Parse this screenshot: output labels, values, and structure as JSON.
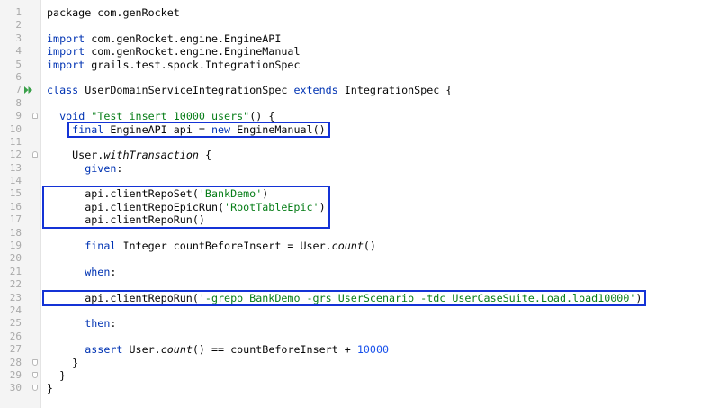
{
  "editor": {
    "lines": [
      {
        "n": "1",
        "tokens": [
          {
            "t": "package com.genRocket",
            "c": ""
          }
        ]
      },
      {
        "n": "2",
        "tokens": []
      },
      {
        "n": "3",
        "tokens": [
          {
            "t": "import",
            "c": "kw"
          },
          {
            "t": " com.genRocket.engine.EngineAPI",
            "c": ""
          }
        ]
      },
      {
        "n": "4",
        "tokens": [
          {
            "t": "import",
            "c": "kw"
          },
          {
            "t": " com.genRocket.engine.EngineManual",
            "c": ""
          }
        ]
      },
      {
        "n": "5",
        "tokens": [
          {
            "t": "import",
            "c": "kw"
          },
          {
            "t": " grails.test.spock.IntegrationSpec",
            "c": ""
          }
        ]
      },
      {
        "n": "6",
        "tokens": []
      },
      {
        "n": "7",
        "tokens": [
          {
            "t": "class",
            "c": "kw"
          },
          {
            "t": " UserDomainServiceIntegrationSpec ",
            "c": ""
          },
          {
            "t": "extends",
            "c": "kw"
          },
          {
            "t": " IntegrationSpec {",
            "c": ""
          }
        ]
      },
      {
        "n": "8",
        "tokens": []
      },
      {
        "n": "9",
        "tokens": [
          {
            "t": "  ",
            "c": ""
          },
          {
            "t": "void",
            "c": "kw"
          },
          {
            "t": " ",
            "c": ""
          },
          {
            "t": "\"Test insert 10000 users\"",
            "c": "str"
          },
          {
            "t": "() {",
            "c": ""
          }
        ]
      },
      {
        "n": "10",
        "tokens": [
          {
            "t": "    ",
            "c": ""
          },
          {
            "t": "final",
            "c": "kw"
          },
          {
            "t": " EngineAPI api = ",
            "c": ""
          },
          {
            "t": "new",
            "c": "kw"
          },
          {
            "t": " EngineManual()",
            "c": ""
          }
        ]
      },
      {
        "n": "11",
        "tokens": []
      },
      {
        "n": "12",
        "tokens": [
          {
            "t": "    User.",
            "c": ""
          },
          {
            "t": "withTransaction",
            "c": "it"
          },
          {
            "t": " {",
            "c": ""
          }
        ]
      },
      {
        "n": "13",
        "tokens": [
          {
            "t": "      ",
            "c": ""
          },
          {
            "t": "given",
            "c": "kw"
          },
          {
            "t": ":",
            "c": ""
          }
        ]
      },
      {
        "n": "14",
        "tokens": []
      },
      {
        "n": "15",
        "tokens": [
          {
            "t": "      api.clientRepoSet(",
            "c": ""
          },
          {
            "t": "'BankDemo'",
            "c": "str"
          },
          {
            "t": ")",
            "c": ""
          }
        ]
      },
      {
        "n": "16",
        "tokens": [
          {
            "t": "      api.clientRepoEpicRun(",
            "c": ""
          },
          {
            "t": "'RootTableEpic'",
            "c": "str"
          },
          {
            "t": ")",
            "c": ""
          }
        ]
      },
      {
        "n": "17",
        "tokens": [
          {
            "t": "      api.clientRepoRun()",
            "c": ""
          }
        ]
      },
      {
        "n": "18",
        "tokens": []
      },
      {
        "n": "19",
        "tokens": [
          {
            "t": "      ",
            "c": ""
          },
          {
            "t": "final",
            "c": "kw"
          },
          {
            "t": " Integer countBeforeInsert = User.",
            "c": ""
          },
          {
            "t": "count",
            "c": "it"
          },
          {
            "t": "()",
            "c": ""
          }
        ]
      },
      {
        "n": "20",
        "tokens": []
      },
      {
        "n": "21",
        "tokens": [
          {
            "t": "      ",
            "c": ""
          },
          {
            "t": "when",
            "c": "kw"
          },
          {
            "t": ":",
            "c": ""
          }
        ]
      },
      {
        "n": "22",
        "tokens": []
      },
      {
        "n": "23",
        "tokens": [
          {
            "t": "      api.clientRepoRun(",
            "c": ""
          },
          {
            "t": "'-grepo BankDemo -grs UserScenario -tdc UserCaseSuite.Load.load10000'",
            "c": "str"
          },
          {
            "t": ")",
            "c": ""
          }
        ]
      },
      {
        "n": "24",
        "tokens": []
      },
      {
        "n": "25",
        "tokens": [
          {
            "t": "      ",
            "c": ""
          },
          {
            "t": "then",
            "c": "kw"
          },
          {
            "t": ":",
            "c": ""
          }
        ]
      },
      {
        "n": "26",
        "tokens": []
      },
      {
        "n": "27",
        "tokens": [
          {
            "t": "      ",
            "c": ""
          },
          {
            "t": "assert",
            "c": "kw"
          },
          {
            "t": " User.",
            "c": ""
          },
          {
            "t": "count",
            "c": "it"
          },
          {
            "t": "() == countBeforeInsert + ",
            "c": ""
          },
          {
            "t": "10000",
            "c": "num"
          }
        ]
      },
      {
        "n": "28",
        "tokens": [
          {
            "t": "    }",
            "c": ""
          }
        ]
      },
      {
        "n": "29",
        "tokens": [
          {
            "t": "  }",
            "c": ""
          }
        ]
      },
      {
        "n": "30",
        "tokens": [
          {
            "t": "}",
            "c": ""
          }
        ]
      }
    ],
    "run_gutter_line": "7",
    "fold_markers": [
      {
        "line": "7",
        "kind": "start"
      },
      {
        "line": "9",
        "kind": "start"
      },
      {
        "line": "12",
        "kind": "start"
      },
      {
        "line": "28",
        "kind": "end"
      },
      {
        "line": "29",
        "kind": "end"
      },
      {
        "line": "30",
        "kind": "end"
      }
    ],
    "highlight_boxes": [
      {
        "name": "highlight-engine-init",
        "from_line": "10",
        "to_line": "10"
      },
      {
        "name": "highlight-repo-setup",
        "from_line": "15",
        "to_line": "17"
      },
      {
        "name": "highlight-repo-run",
        "from_line": "23",
        "to_line": "23"
      }
    ],
    "colors": {
      "keyword": "#0033b3",
      "string": "#067d17",
      "number": "#1750eb",
      "text": "#080808",
      "line_number": "#a9a9a9",
      "gutter_bg": "#f4f4f4",
      "highlight_box": "#1433d6",
      "run_icon": "#3aa04a"
    }
  }
}
